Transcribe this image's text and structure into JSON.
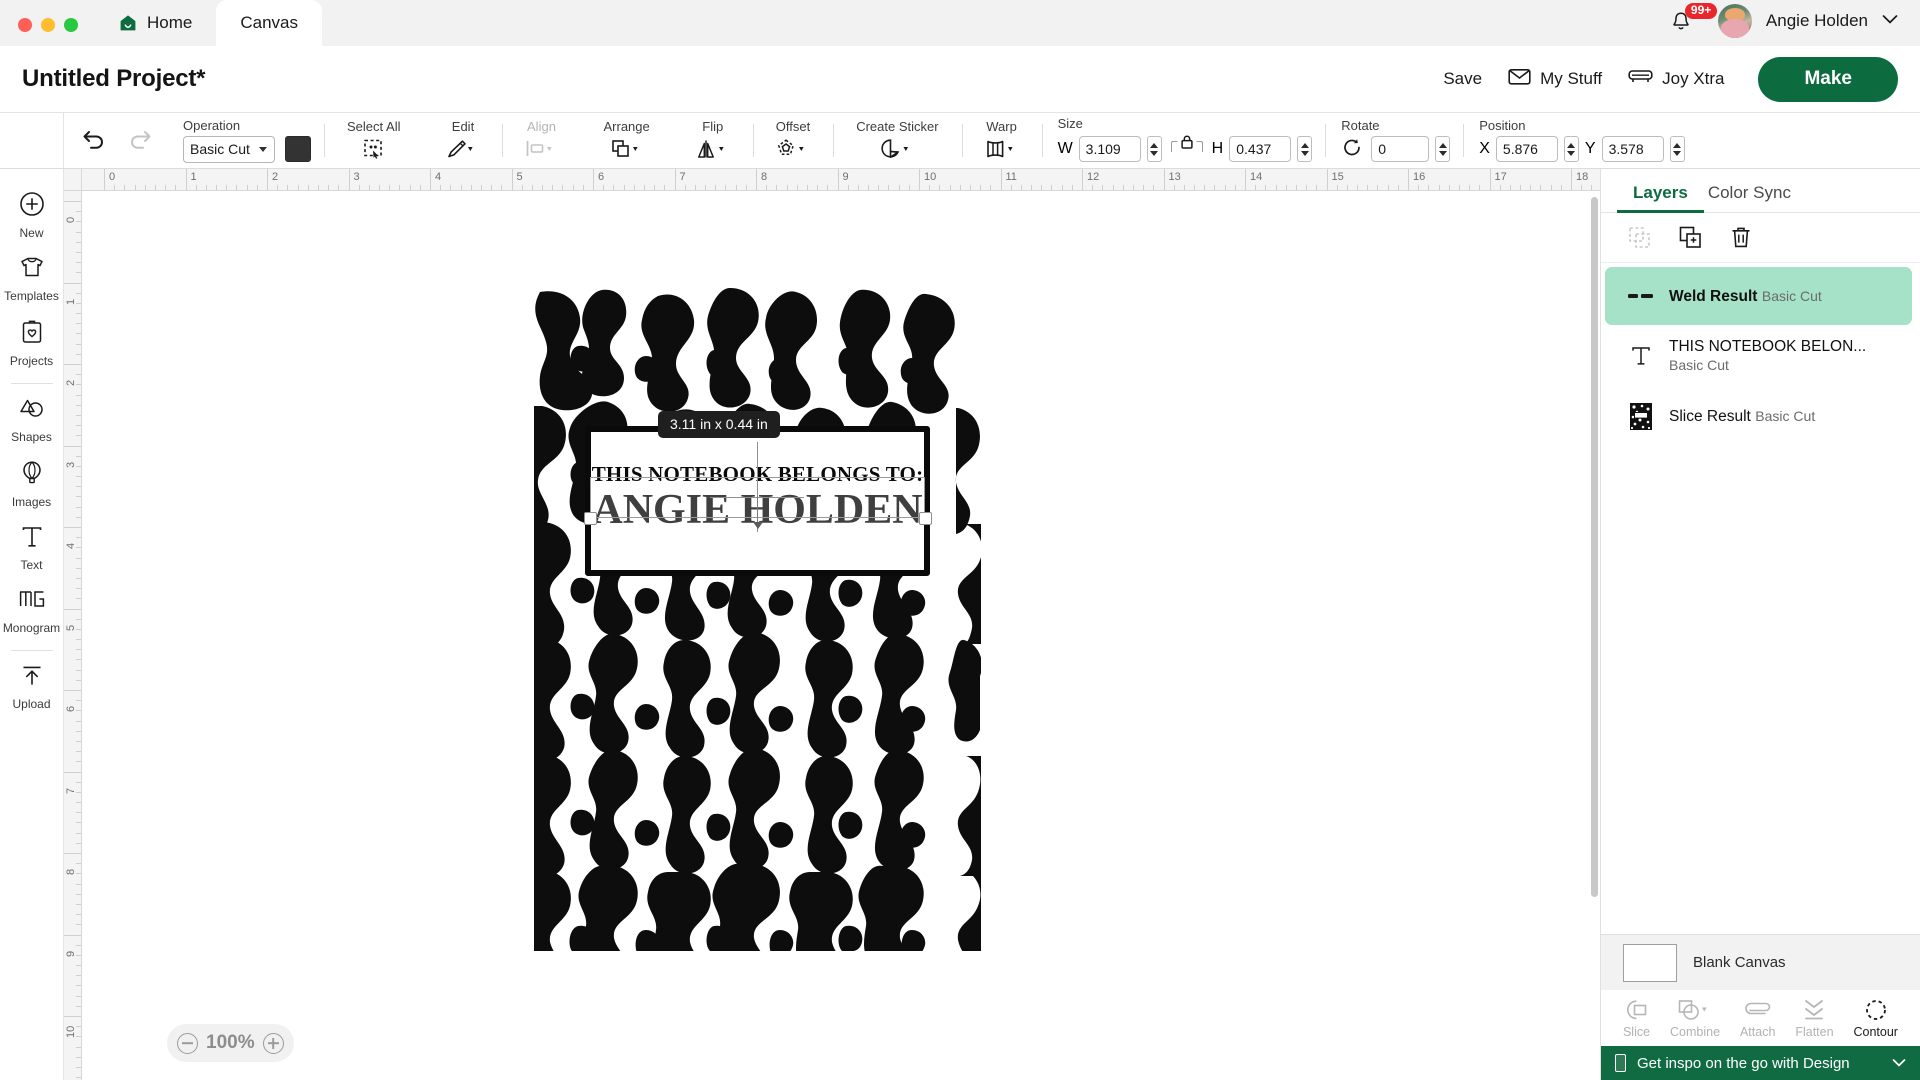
{
  "window": {
    "traffic_lights": [
      "close",
      "minimize",
      "zoom"
    ],
    "tabs": [
      {
        "label": "Home",
        "icon": "home-icon",
        "active": false
      },
      {
        "label": "Canvas",
        "icon": "",
        "active": true
      }
    ],
    "notification_badge": "99+",
    "user_name": "Angie Holden"
  },
  "header": {
    "project_title": "Untitled Project*",
    "save_label": "Save",
    "my_stuff_label": "My Stuff",
    "joy_xtra_label": "Joy Xtra",
    "make_label": "Make"
  },
  "toolbar": {
    "undo": "undo-icon",
    "redo": "redo-icon",
    "operation": {
      "label": "Operation",
      "value": "Basic Cut",
      "color": "#333333"
    },
    "select_all": {
      "label": "Select All"
    },
    "edit": {
      "label": "Edit"
    },
    "align": {
      "label": "Align",
      "disabled": true
    },
    "arrange": {
      "label": "Arrange"
    },
    "flip": {
      "label": "Flip"
    },
    "offset": {
      "label": "Offset"
    },
    "create_sticker": {
      "label": "Create Sticker"
    },
    "warp": {
      "label": "Warp"
    },
    "size": {
      "label": "Size",
      "w_label": "W",
      "w_value": "3.109",
      "h_label": "H",
      "h_value": "0.437",
      "lock": "lock-icon"
    },
    "rotate": {
      "label": "Rotate",
      "value": "0"
    },
    "position": {
      "label": "Position",
      "x_label": "X",
      "x_value": "5.876",
      "y_label": "Y",
      "y_value": "3.578"
    }
  },
  "rail": {
    "items": [
      {
        "label": "New",
        "icon": "plus-circle-icon"
      },
      {
        "label": "Templates",
        "icon": "tshirt-icon"
      },
      {
        "label": "Projects",
        "icon": "card-heart-icon"
      },
      {
        "label": "Shapes",
        "icon": "shapes-icon"
      },
      {
        "label": "Images",
        "icon": "hot-air-balloon-icon"
      },
      {
        "label": "Text",
        "icon": "text-t-icon"
      },
      {
        "label": "Monogram",
        "icon": "monogram-icon"
      },
      {
        "label": "Upload",
        "icon": "upload-arrow-icon"
      }
    ]
  },
  "canvas": {
    "ruler_h_labels": [
      "0",
      "1",
      "2",
      "3",
      "4",
      "5",
      "6",
      "7",
      "8",
      "9",
      "10",
      "11",
      "12",
      "13",
      "14",
      "15",
      "16",
      "17",
      "18"
    ],
    "ruler_v_labels": [
      "0",
      "1",
      "2",
      "3",
      "4",
      "5",
      "6",
      "7",
      "8",
      "9",
      "10"
    ],
    "zoom_level": "100%",
    "selection_badge": "3.11  in x 0.44  in",
    "artwork": {
      "line1": "THIS NOTEBOOK BELONGS TO:",
      "line2": "ANGIE HOLDEN",
      "pattern": "composition-notebook-marble"
    }
  },
  "right_panel": {
    "tabs": [
      {
        "label": "Layers",
        "active": true
      },
      {
        "label": "Color Sync",
        "active": false
      }
    ],
    "tools": [
      {
        "name": "group-icon",
        "disabled": true
      },
      {
        "name": "duplicate-icon",
        "disabled": false
      },
      {
        "name": "delete-icon",
        "disabled": false
      }
    ],
    "layers": [
      {
        "name": "Weld Result",
        "type": "Basic Cut",
        "icon": "weld-dashes-icon",
        "selected": true
      },
      {
        "name": "THIS NOTEBOOK BELON...",
        "type": "Basic Cut",
        "icon": "text-t-icon",
        "selected": false
      },
      {
        "name": "Slice Result",
        "type": "Basic Cut",
        "icon": "notebook-thumb-icon",
        "selected": false
      }
    ],
    "blank_canvas_label": "Blank Canvas",
    "bottom_tools": [
      {
        "label": "Slice",
        "icon": "slice-icon",
        "enabled": false
      },
      {
        "label": "Combine",
        "icon": "combine-icon",
        "enabled": false,
        "has_caret": true
      },
      {
        "label": "Attach",
        "icon": "attach-paperclip-icon",
        "enabled": false
      },
      {
        "label": "Flatten",
        "icon": "flatten-icon",
        "enabled": false
      },
      {
        "label": "Contour",
        "icon": "contour-dashed-circle-icon",
        "enabled": true
      }
    ],
    "promo_text": "Get inspo on the go with Design",
    "promo_icon": "phone-icon"
  },
  "colors": {
    "brand_green": "#0d6b40",
    "selected_layer": "#a6e2c8",
    "badge_red": "#e8262b",
    "swatch": "#333333"
  }
}
